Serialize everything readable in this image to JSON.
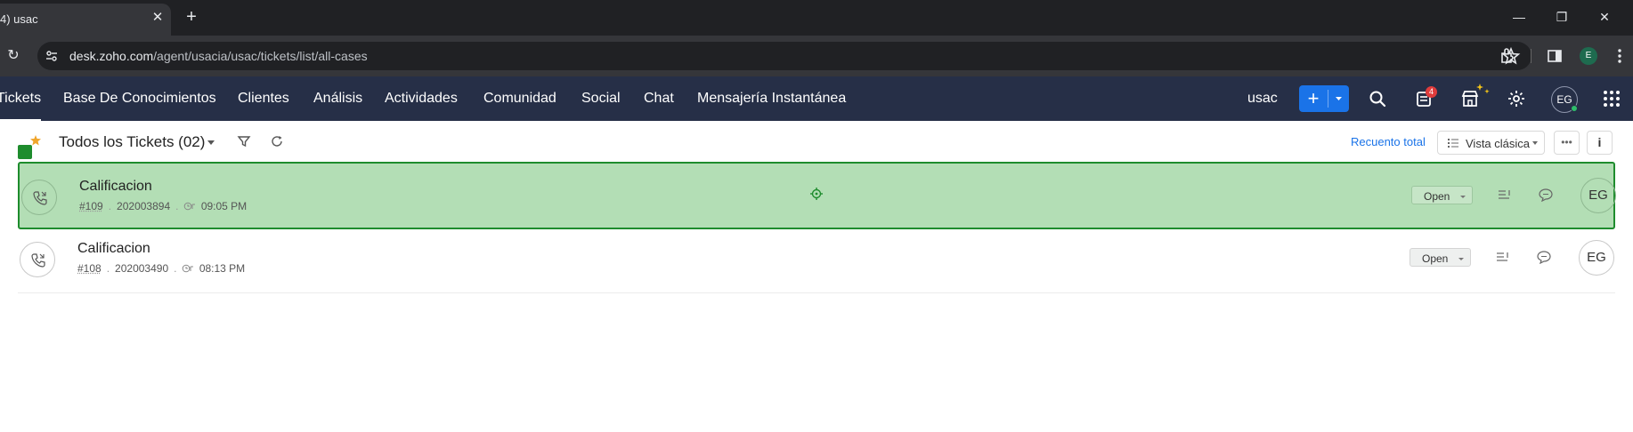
{
  "browser": {
    "tab_title": "4) usac",
    "tab_close": "✕",
    "new_tab": "+",
    "window_controls": {
      "minimize": "—",
      "restore": "❐",
      "close": "✕"
    },
    "url_host": "desk.zoho.com",
    "url_path": "/agent/usacia/usac/tickets/list/all-cases",
    "profile_initial": "E"
  },
  "nav": {
    "items": [
      {
        "label": "Tickets",
        "active": true
      },
      {
        "label": "Base De Conocimientos"
      },
      {
        "label": "Clientes"
      },
      {
        "label": "Análisis"
      },
      {
        "label": "Actividades"
      },
      {
        "label": "Comunidad"
      },
      {
        "label": "Social"
      },
      {
        "label": "Chat"
      },
      {
        "label": "Mensajería Instantánea"
      }
    ],
    "department": "usac",
    "add_symbol": "+",
    "notification_count": "4",
    "avatar_initials": "EG"
  },
  "view": {
    "title": "Todos los Tickets (02)",
    "recount_label": "Recuento total",
    "classic_view_label": "Vista clásica",
    "more_label": "•••",
    "info_label": "i"
  },
  "tickets": [
    {
      "subject": "Calificacion",
      "number": "#109",
      "contact_id": "202003894",
      "time": "09:05 PM",
      "status": "Open",
      "assignee": "EG",
      "selected": true
    },
    {
      "subject": "Calificacion",
      "number": "#108",
      "contact_id": "202003490",
      "time": "08:13 PM",
      "status": "Open",
      "assignee": "EG",
      "selected": false
    }
  ],
  "colors": {
    "nav_bg": "#262f47",
    "accent_blue": "#1a73e8",
    "selection_green": "#b3deb5",
    "selection_border": "#1e8c2d"
  }
}
